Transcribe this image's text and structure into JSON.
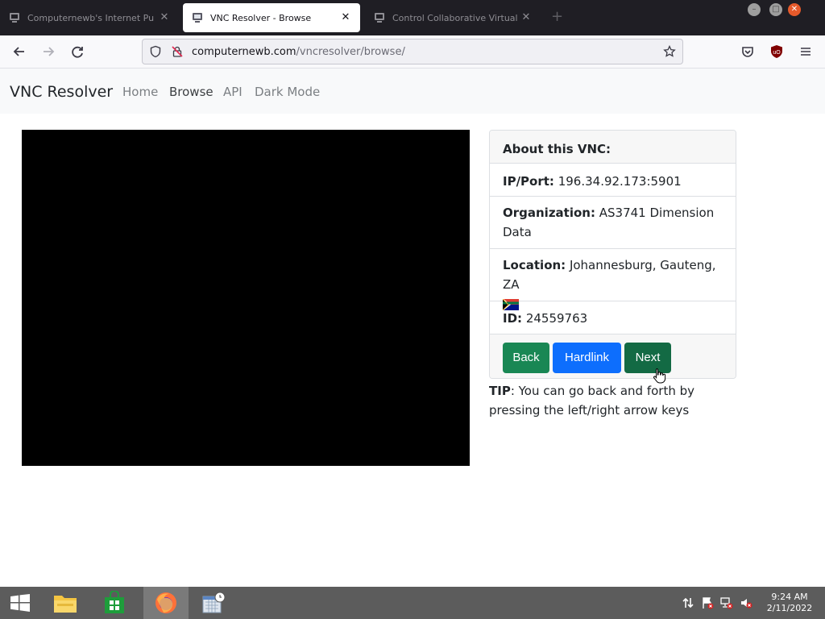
{
  "browser": {
    "tabs": [
      {
        "title": "Computernewb's Internet Pu",
        "active": false
      },
      {
        "title": "VNC Resolver - Browse",
        "active": true
      },
      {
        "title": "Control Collaborative Virtual",
        "active": false
      }
    ],
    "url_domain": "computernewb.com",
    "url_path": "/vncresolver/browse/"
  },
  "site": {
    "brand": "VNC Resolver",
    "nav": [
      "Home",
      "Browse",
      "API",
      "Dark Mode"
    ]
  },
  "info_card": {
    "header": "About this VNC:",
    "ip_label": "IP/Port:",
    "ip_value": "196.34.92.173:5901",
    "org_label": "Organization:",
    "org_value": "AS3741 Dimension Data",
    "loc_label": "Location:",
    "loc_value": "Johannesburg, Gauteng, ZA",
    "id_label": "ID:",
    "id_value": "24559763",
    "buttons": {
      "back": "Back",
      "hardlink": "Hardlink",
      "next": "Next"
    }
  },
  "tip": {
    "label": "TIP",
    "text": ": You can go back and forth by pressing the left/right arrow keys"
  },
  "taskbar": {
    "time": "9:24 AM",
    "date": "2/11/2022"
  },
  "colors": {
    "back_button": "#198754",
    "hardlink_button": "#0d6efd",
    "next_button": "#136a44",
    "vnc_screen": "#000000"
  }
}
